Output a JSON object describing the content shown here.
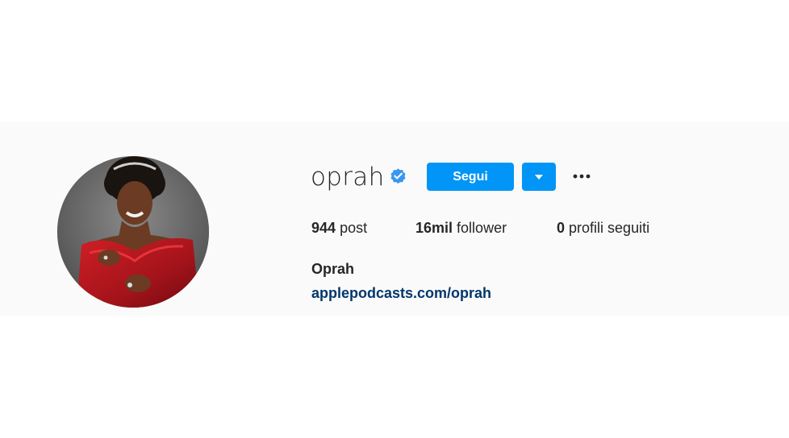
{
  "profile": {
    "username": "oprah",
    "verified": true,
    "full_name": "Oprah",
    "website": "applepodcasts.com/oprah"
  },
  "actions": {
    "follow_label": "Segui",
    "dropdown_icon": "triangle-down-icon",
    "more_icon": "ellipsis-icon"
  },
  "stats": {
    "posts": {
      "value": "944",
      "label": "post"
    },
    "followers": {
      "value": "16mil",
      "label": "follower"
    },
    "following": {
      "value": "0",
      "label": "profili seguiti"
    }
  },
  "colors": {
    "accent": "#0095f6",
    "link": "#00376b",
    "text": "#262626",
    "band": "#fafafa"
  }
}
